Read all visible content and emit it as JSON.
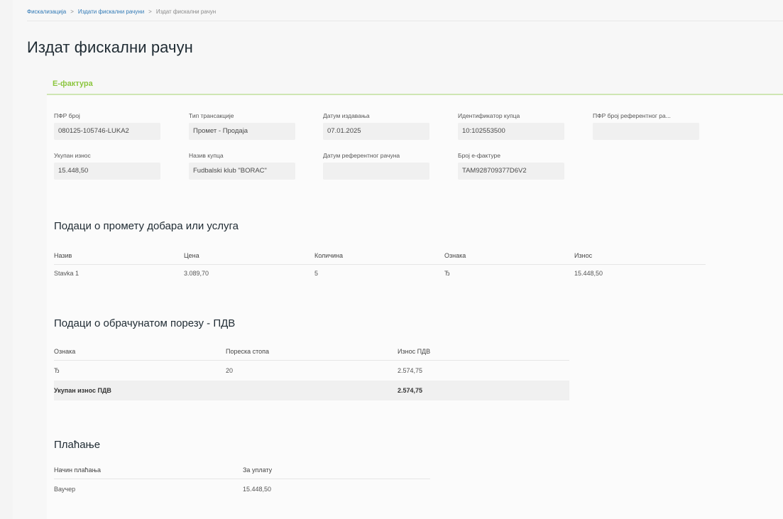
{
  "breadcrumb": {
    "items": [
      "Фискализација",
      "Издати фискални рачуни",
      "Издат фискални рачун"
    ]
  },
  "page": {
    "title": "Издат фискални рачун"
  },
  "section": {
    "tab_label": "Е-фактура"
  },
  "fields": {
    "pfr_broj": {
      "label": "ПФР број",
      "value": "080125-105746-LUKA2"
    },
    "tip_transakcije": {
      "label": "Тип трансакције",
      "value": "Промет - Продаја"
    },
    "datum_izdavanja": {
      "label": "Датум издавања",
      "value": "07.01.2025"
    },
    "identifikator_kupca": {
      "label": "Идентификатор купца",
      "value": "10:102553500"
    },
    "pfr_referentni": {
      "label": "ПФР број референтног ра...",
      "value": ""
    },
    "ukupan_iznos": {
      "label": "Укупан износ",
      "value": "15.448,50"
    },
    "naziv_kupca": {
      "label": "Назив купца",
      "value": "Fudbalski klub \"BORAC\""
    },
    "datum_referentnog": {
      "label": "Датум референтног рачуна",
      "value": ""
    },
    "broj_efakture": {
      "label": "Број е-фактуре",
      "value": "TAM928709377D6V2"
    }
  },
  "items_section": {
    "title": "Подаци о промету добара или услуга",
    "headers": [
      "Назив",
      "Цена",
      "Количина",
      "Ознака",
      "Износ"
    ],
    "rows": [
      [
        "Stavka 1",
        "3.089,70",
        "5",
        "Ђ",
        "15.448,50"
      ]
    ]
  },
  "tax_section": {
    "title": "Подаци о обрачунатом порезу - ПДВ",
    "headers": [
      "Ознака",
      "Пореска стопа",
      "Износ ПДВ"
    ],
    "rows": [
      [
        "Ђ",
        "20",
        "2.574,75"
      ]
    ],
    "total_label": "Укупан износ ПДВ",
    "total_value": "2.574,75"
  },
  "payment_section": {
    "title": "Плаћање",
    "headers": [
      "Начин плаћања",
      "За уплату"
    ],
    "rows": [
      [
        "Ваучер",
        "15.448,50"
      ]
    ]
  },
  "colors": {
    "accent_green": "#8cc63f",
    "link_blue": "#2f78b5"
  }
}
